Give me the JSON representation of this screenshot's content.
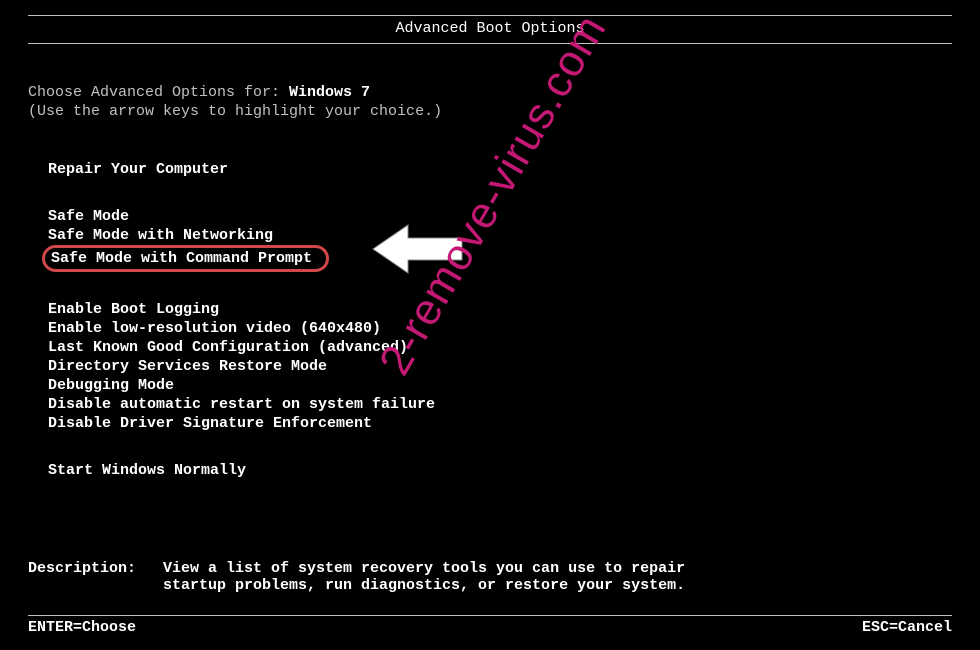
{
  "title": "Advanced Boot Options",
  "choose_prefix": "Choose Advanced Options for: ",
  "os_name": "Windows 7",
  "instruction": "(Use the arrow keys to highlight your choice.)",
  "menu": {
    "group1": [
      "Repair Your Computer"
    ],
    "group2": [
      "Safe Mode",
      "Safe Mode with Networking",
      "Safe Mode with Command Prompt"
    ],
    "group3": [
      "Enable Boot Logging",
      "Enable low-resolution video (640x480)",
      "Last Known Good Configuration (advanced)",
      "Directory Services Restore Mode",
      "Debugging Mode",
      "Disable automatic restart on system failure",
      "Disable Driver Signature Enforcement"
    ],
    "group4": [
      "Start Windows Normally"
    ]
  },
  "description": {
    "label": "Description:",
    "text": "View a list of system recovery tools you can use to repair startup problems, run diagnostics, or restore your system."
  },
  "footer": {
    "left": "ENTER=Choose",
    "right": "ESC=Cancel"
  },
  "watermark": "2-remove-virus.com"
}
